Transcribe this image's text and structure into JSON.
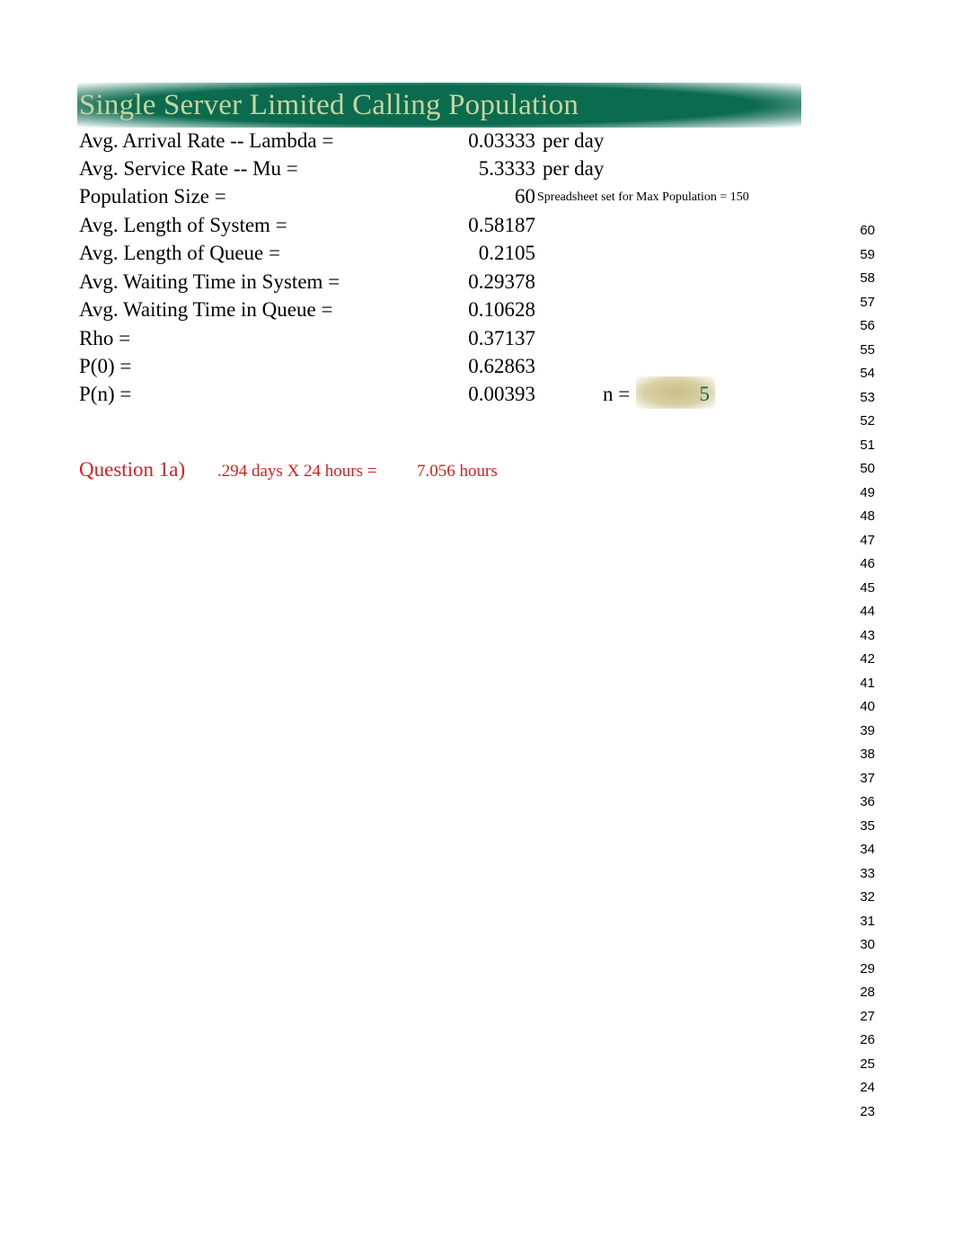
{
  "title": "Single Server Limited Calling Population",
  "rows": [
    {
      "label": "Avg. Arrival Rate -- Lambda =",
      "value": "0.03333",
      "unit": "per day",
      "note": ""
    },
    {
      "label": "Avg. Service Rate -- Mu =",
      "value": "5.3333",
      "unit": "per day",
      "note": ""
    },
    {
      "label": "Population Size =",
      "value": "60",
      "unit": "",
      "note": "Spreadsheet set for Max Population = 150"
    },
    {
      "label": "Avg. Length of System =",
      "value": "0.58187",
      "unit": "",
      "note": ""
    },
    {
      "label": "Avg. Length of Queue =",
      "value": "0.2105",
      "unit": "",
      "note": ""
    },
    {
      "label": "Avg. Waiting Time in System =",
      "value": "0.29378",
      "unit": "",
      "note": ""
    },
    {
      "label": "Avg. Waiting Time in Queue =",
      "value": "0.10628",
      "unit": "",
      "note": ""
    },
    {
      "label": "Rho =",
      "value": "0.37137",
      "unit": "",
      "note": ""
    },
    {
      "label": "P(0) =",
      "value": "0.62863",
      "unit": "",
      "note": ""
    },
    {
      "label": "P(n) =",
      "value": "0.00393",
      "unit": "",
      "note": ""
    }
  ],
  "n_input": {
    "label": "n =",
    "value": "5"
  },
  "question": {
    "label": "Question 1a)",
    "calc": ".294 days X 24 hours =",
    "result": "7.056 hours"
  },
  "index_column": [
    "60",
    "59",
    "58",
    "57",
    "56",
    "55",
    "54",
    "53",
    "52",
    "51",
    "50",
    "49",
    "48",
    "47",
    "46",
    "45",
    "44",
    "43",
    "42",
    "41",
    "40",
    "39",
    "38",
    "37",
    "36",
    "35",
    "34",
    "33",
    "32",
    "31",
    "30",
    "29",
    "28",
    "27",
    "26",
    "25",
    "24",
    "23"
  ],
  "colors": {
    "banner": "#0b6b4f",
    "title_text": "#c8d3a0",
    "question_red": "#e01b1b",
    "n_value_green": "#0b6b4f",
    "n_highlight": "#cbbf86"
  }
}
